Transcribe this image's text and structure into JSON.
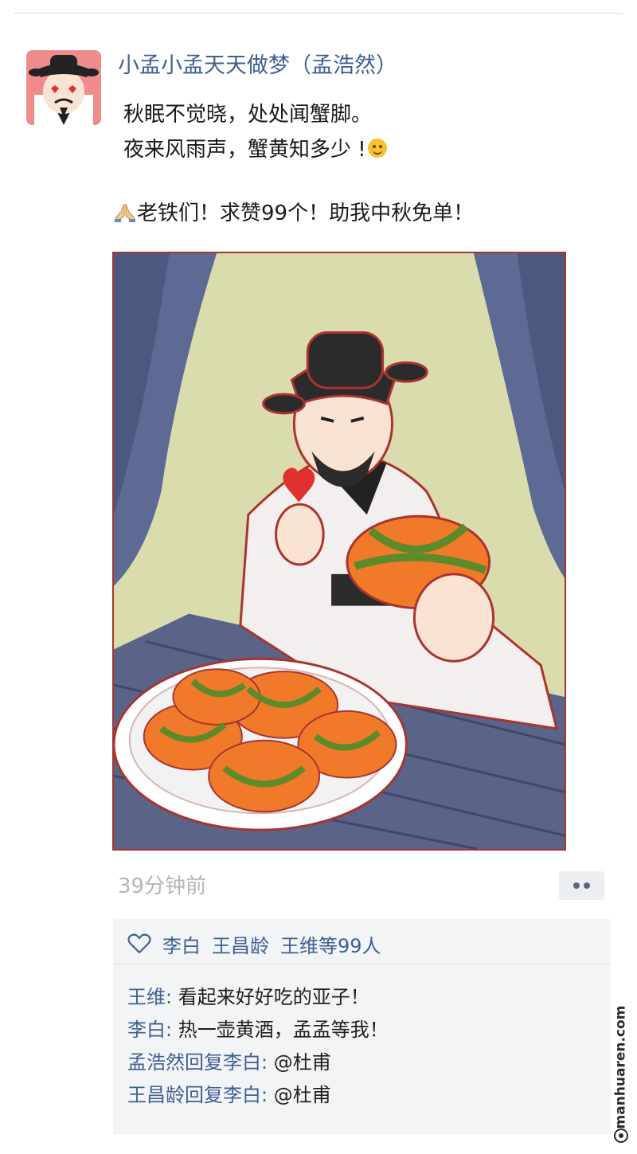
{
  "post": {
    "username": "小孟小孟天天做梦（孟浩然）",
    "poem_line1": "秋眠不觉晓，处处闻蟹脚。",
    "poem_line2": "夜来风雨声，蟹黄知多少 !",
    "request": "老铁们！求赞99个！助我中秋免单！",
    "time": "39分钟前"
  },
  "likes": {
    "names": [
      "李白",
      "王昌龄",
      "王维等99人"
    ]
  },
  "comments": [
    {
      "who": "王维:",
      "text": " 看起来好好吃的亚子！"
    },
    {
      "who": "李白:",
      "text": " 热一壶黄酒，孟孟等我！"
    },
    {
      "who": "孟浩然回复李白:",
      "text": " @杜甫"
    },
    {
      "who": "王昌龄回复李白:",
      "text": " @杜甫"
    }
  ],
  "watermark": "manhuaren.com",
  "icons": {
    "like": "heart-outline-icon",
    "emoji": "smiley-emoji-icon",
    "pray": "praying-hands-emoji-icon",
    "more": "more-dots-icon"
  },
  "colors": {
    "name_blue": "#3f5f93",
    "time_gray": "#b5b5b5",
    "panel_bg": "#f3f4f6",
    "frame_red": "#a9342f"
  }
}
